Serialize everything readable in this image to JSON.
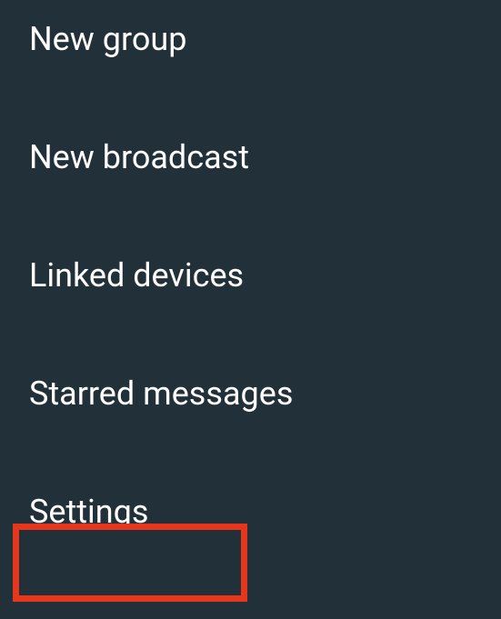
{
  "menu": {
    "items": [
      {
        "label": "New group"
      },
      {
        "label": "New broadcast"
      },
      {
        "label": "Linked devices"
      },
      {
        "label": "Starred messages"
      },
      {
        "label": "Settings"
      }
    ]
  }
}
